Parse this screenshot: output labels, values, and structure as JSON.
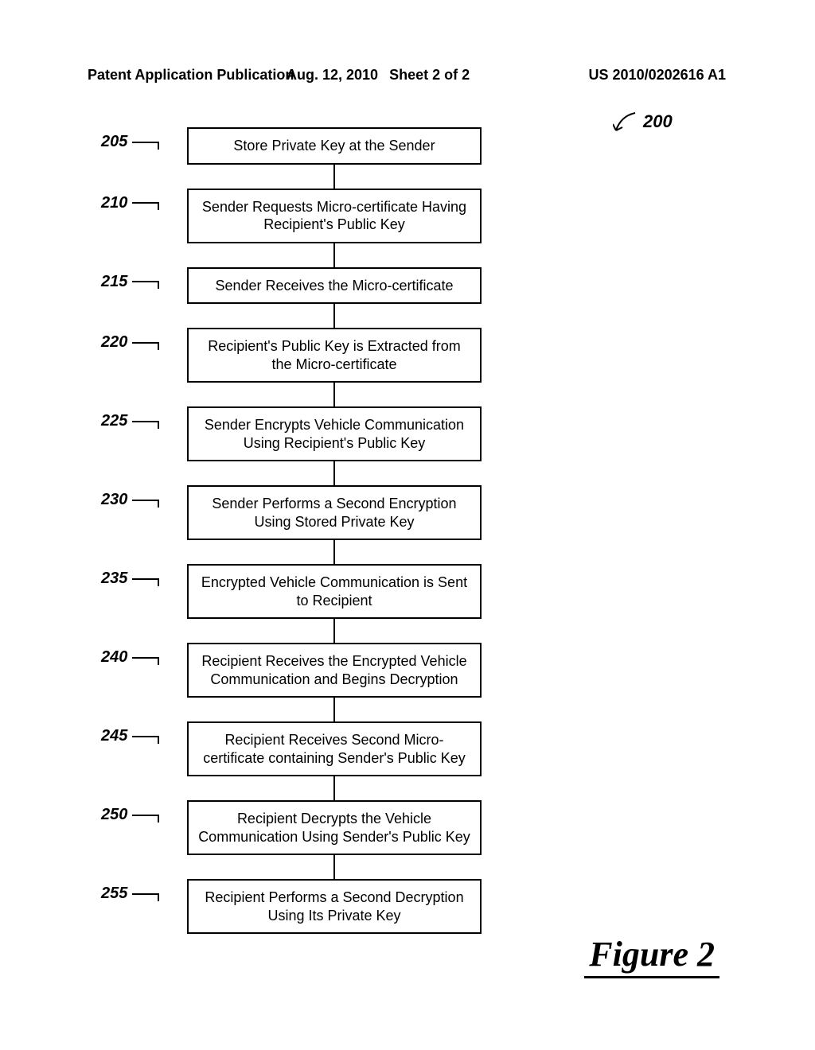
{
  "header": {
    "left": "Patent Application Publication",
    "date": "Aug. 12, 2010",
    "sheet": "Sheet 2 of 2",
    "pubno": "US 2010/0202616 A1"
  },
  "overall_ref": "200",
  "figure_label": "Figure 2",
  "steps": [
    {
      "ref": "205",
      "text": "Store Private Key at the Sender"
    },
    {
      "ref": "210",
      "text": "Sender Requests Micro-certificate Having Recipient's Public Key"
    },
    {
      "ref": "215",
      "text": "Sender Receives the Micro-certificate"
    },
    {
      "ref": "220",
      "text": "Recipient's Public Key is Extracted from the Micro-certificate"
    },
    {
      "ref": "225",
      "text": "Sender Encrypts Vehicle Communication Using Recipient's Public Key"
    },
    {
      "ref": "230",
      "text": "Sender Performs a Second Encryption Using Stored Private Key"
    },
    {
      "ref": "235",
      "text": "Encrypted Vehicle Communication is Sent to Recipient"
    },
    {
      "ref": "240",
      "text": "Recipient Receives the Encrypted Vehicle Communication and Begins Decryption"
    },
    {
      "ref": "245",
      "text": "Recipient Receives Second Micro-certificate containing Sender's Public Key"
    },
    {
      "ref": "250",
      "text": "Recipient Decrypts the Vehicle Communication Using Sender's Public Key"
    },
    {
      "ref": "255",
      "text": "Recipient Performs a Second Decryption Using Its Private Key"
    }
  ]
}
